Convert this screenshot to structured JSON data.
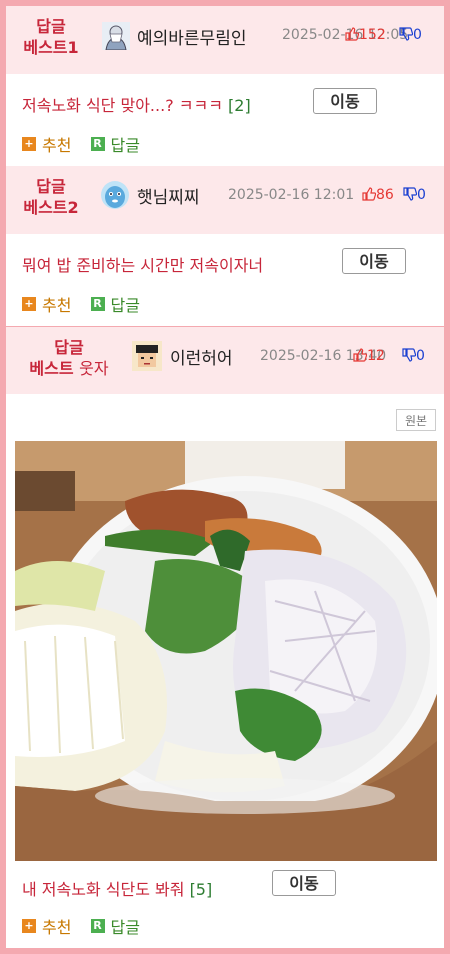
{
  "posts": [
    {
      "rank_label": "답글",
      "rank_num": "베스트1",
      "rank_extra": "",
      "nickname": "예의바른무림인",
      "date": "2025-02-16 12:05",
      "upvotes": "152",
      "downvotes": "0",
      "title": "저속노화 식단 맞아...? ㅋㅋㅋ",
      "comment_count": "[2]",
      "move_label": "이동",
      "recommend_label": "추천",
      "reply_label": "답글"
    },
    {
      "rank_label": "답글",
      "rank_num": "베스트2",
      "rank_extra": "",
      "nickname": "햇님찌찌",
      "date": "2025-02-16 12:01",
      "upvotes": "86",
      "downvotes": "0",
      "title": "뭐여 밥 준비하는 시간만 저속이자너",
      "comment_count": "",
      "move_label": "이동",
      "recommend_label": "추천",
      "reply_label": "답글"
    },
    {
      "rank_label": "답글",
      "rank_num": "베스트",
      "rank_extra": "웃자",
      "nickname": "이런허어",
      "date": "2025-02-16 13:40",
      "upvotes": "12",
      "downvotes": "0",
      "title": "내 저속노화 식단도 봐줘",
      "comment_count": "[5]",
      "move_label": "이동",
      "recommend_label": "추천",
      "reply_label": "답글",
      "original_label": "원본"
    }
  ],
  "colors": {
    "border": "#f4a9b0",
    "header_bg": "#fde8ea",
    "rank_red": "#c7263a",
    "up_red": "#e53935",
    "down_blue": "#1a3fd1",
    "count_green": "#2e7d32"
  }
}
